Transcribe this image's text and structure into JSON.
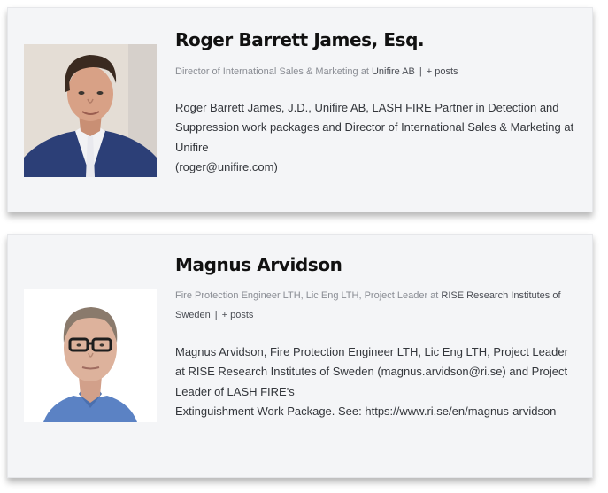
{
  "authors": [
    {
      "name": "Roger Barrett James, Esq.",
      "title_prefix": "Director of International Sales & Marketing at ",
      "company": "Unifire AB",
      "posts_label": "+ posts",
      "bio_main": "Roger Barrett James, J.D., Unifire AB, LASH FIRE Partner in Detection and Suppression work packages and Director of International Sales & Marketing at Unifire",
      "bio_email": "(roger@unifire.com)",
      "photo_icon": "person-photo"
    },
    {
      "name": "Magnus Arvidson",
      "title_prefix": "Fire Protection Engineer LTH, Lic Eng LTH, Project Leader at ",
      "company": "RISE Research Institutes of Sweden",
      "posts_label": "+ posts",
      "bio_main": "Magnus Arvidson, Fire Protection Engineer LTH, Lic Eng LTH, Project Leader at RISE Research Institutes of Sweden (magnus.arvidson@ri.se) and Project Leader of LASH FIRE's",
      "bio_email": "Extinguishment Work Package. See: https://www.ri.se/en/magnus-arvidson",
      "photo_icon": "person-photo"
    }
  ],
  "colors": {
    "card_bg": "#f4f5f7",
    "name": "#111111",
    "meta": "#8a8d94",
    "bio": "#33363b"
  }
}
